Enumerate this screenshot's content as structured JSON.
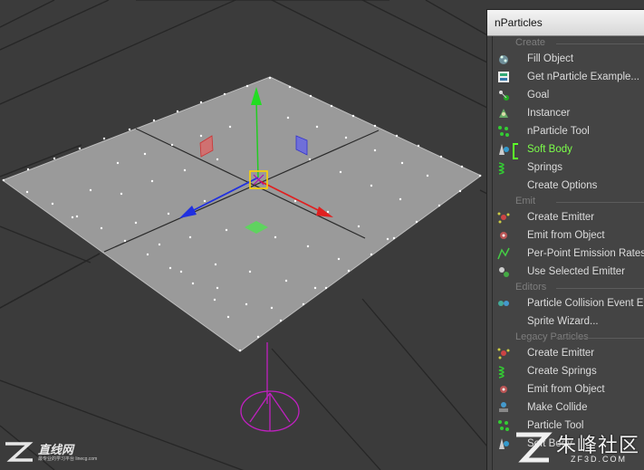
{
  "window": {
    "title": "nParticles"
  },
  "sections": [
    {
      "label": "Create",
      "items": [
        {
          "label": "Fill Object",
          "icon": "fill-object-icon"
        },
        {
          "label": "Get nParticle Example...",
          "icon": "example-icon"
        },
        {
          "label": "Goal",
          "icon": "goal-icon"
        },
        {
          "label": "Instancer",
          "icon": "instancer-icon"
        },
        {
          "label": "nParticle Tool",
          "icon": "particle-tool-icon"
        },
        {
          "label": "Soft Body",
          "icon": "soft-body-icon",
          "highlighted": true
        },
        {
          "label": "Springs",
          "icon": "springs-icon"
        },
        {
          "label": "Create Options",
          "icon": ""
        }
      ]
    },
    {
      "label": "Emit",
      "items": [
        {
          "label": "Create Emitter",
          "icon": "emitter-icon"
        },
        {
          "label": "Emit from Object",
          "icon": "emit-object-icon"
        },
        {
          "label": "Per-Point Emission Rates",
          "icon": "emission-rates-icon"
        },
        {
          "label": "Use Selected Emitter",
          "icon": "selected-emitter-icon"
        }
      ]
    },
    {
      "label": "Editors",
      "items": [
        {
          "label": "Particle Collision Event Ed",
          "icon": "collision-event-icon"
        },
        {
          "label": "Sprite Wizard...",
          "icon": ""
        }
      ]
    },
    {
      "label": "Legacy Particles",
      "items": [
        {
          "label": "Create Emitter",
          "icon": "emitter-icon"
        },
        {
          "label": "Create Springs",
          "icon": "springs-icon"
        },
        {
          "label": "Emit from Object",
          "icon": "emit-object-icon"
        },
        {
          "label": "Make Collide",
          "icon": "make-collide-icon"
        },
        {
          "label": "Particle Tool",
          "icon": "particle-tool-icon"
        },
        {
          "label": "Soft Body",
          "icon": "soft-body-icon"
        }
      ]
    }
  ],
  "watermarks": {
    "left_title": "直线网",
    "left_sub": "最专业的学习平台 linecg.com",
    "right_title": "朱峰社区",
    "right_sub": "ZF3D.COM"
  },
  "colors": {
    "highlight": "#7cff4a",
    "axis_x": "#e02020",
    "axis_y": "#22cc22",
    "axis_z": "#2030e0",
    "emitter": "#c020c0"
  }
}
